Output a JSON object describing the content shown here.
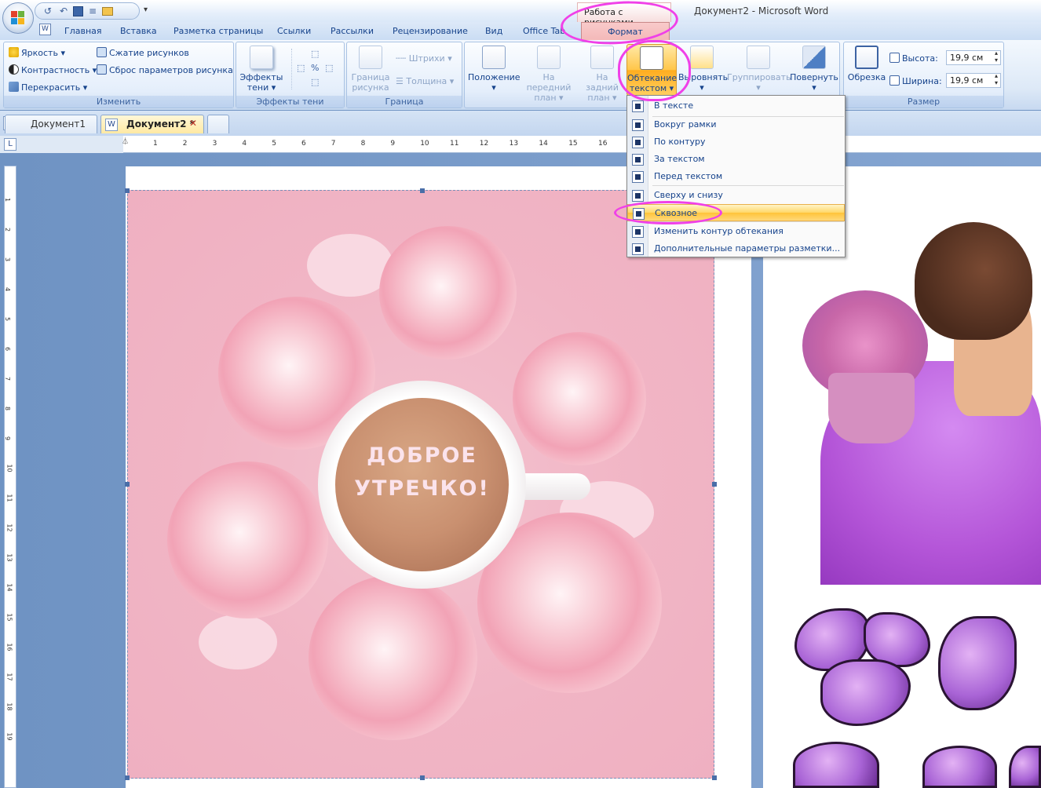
{
  "window": {
    "title": "Документ2 - Microsoft Word",
    "context_tab_group": "Работа с рисунками"
  },
  "ribbon_tabs": [
    "Главная",
    "Вставка",
    "Разметка страницы",
    "Ссылки",
    "Рассылки",
    "Рецензирование",
    "Вид",
    "Office Tab"
  ],
  "active_tab": "Формат",
  "groups": {
    "adjust": {
      "label": "Изменить",
      "brightness": "Яркость",
      "contrast": "Контрастность",
      "recolor": "Перекрасить",
      "compress": "Сжатие рисунков",
      "reset": "Сброс параметров рисунка"
    },
    "shadow": {
      "label": "Эффекты тени",
      "effects_line1": "Эффекты",
      "effects_line2": "тени"
    },
    "border": {
      "label": "Граница",
      "border_line1": "Граница",
      "border_line2": "рисунка",
      "dashes": "Штрихи",
      "weight": "Толщина"
    },
    "arrange": {
      "position": "Положение",
      "front_line1": "На передний",
      "front_line2": "план",
      "back_line1": "На задний",
      "back_line2": "план",
      "wrap_line1": "Обтекание",
      "wrap_line2": "текстом",
      "align": "Выровнять",
      "group": "Группировать",
      "rotate": "Повернуть"
    },
    "size": {
      "label": "Размер",
      "crop": "Обрезка",
      "height_label": "Высота:",
      "height_value": "19,9 см",
      "width_label": "Ширина:",
      "width_value": "19,9 см"
    }
  },
  "document_tabs": [
    {
      "label": "Документ1",
      "active": false
    },
    {
      "label": "Документ2 *",
      "active": true
    }
  ],
  "ruler_numbers": [
    "1",
    "2",
    "3",
    "4",
    "5",
    "6",
    "7",
    "8",
    "9",
    "10",
    "11",
    "12",
    "13",
    "14",
    "15",
    "16"
  ],
  "vruler_numbers": [
    "1",
    "2",
    "3",
    "4",
    "5",
    "6",
    "7",
    "8",
    "9",
    "10",
    "11",
    "12",
    "13",
    "14",
    "15",
    "16",
    "17",
    "18",
    "19"
  ],
  "wrap_menu": {
    "items": [
      "В тексте",
      "Вокруг рамки",
      "По контуру",
      "За текстом",
      "Перед текстом",
      "Сверху и снизу",
      "Сквозное",
      "Изменить контур обтекания",
      "Дополнительные параметры разметки..."
    ],
    "selected": "Сквозное"
  },
  "image_text": {
    "line1": "ДОБРОЕ",
    "line2": "УТРЕЧКО!"
  },
  "colors": {
    "annotation": "#f040e8",
    "menu_highlight": "#ffd767",
    "ribbon_accent": "#15428b"
  }
}
